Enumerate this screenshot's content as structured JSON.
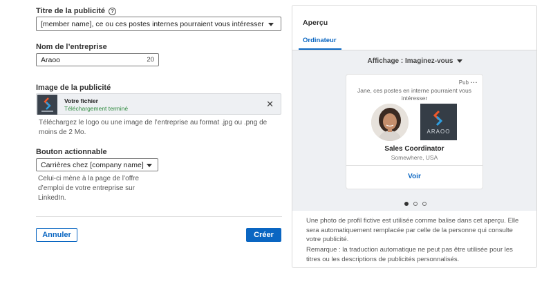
{
  "form": {
    "ad_title": {
      "label": "Titre de la publicité",
      "help_icon": "question-circle",
      "value": "[member name], ce ou ces postes internes pourraient vous intéresser"
    },
    "company_name": {
      "label": "Nom de l’entreprise",
      "value": "Araoo",
      "counter": "20"
    },
    "ad_image": {
      "label": "Image de la publicité",
      "file_label": "Votre fichier",
      "file_status": "Téléchargement terminé",
      "hint": "Téléchargez le logo ou une image de l’entreprise au format .jpg ou .png de moins de 2 Mo."
    },
    "cta_button": {
      "label": "Bouton actionnable",
      "value": "Carrières chez [company name]",
      "hint": "Celui-ci mène à la page de l’offre d’emploi de votre entreprise sur LinkedIn."
    }
  },
  "actions": {
    "cancel_label": "Annuler",
    "create_label": "Créer"
  },
  "preview": {
    "title": "Aperçu",
    "tab_label": "Ordinateur",
    "display_selector": "Affichage : Imaginez-vous",
    "card": {
      "badge": "Pub",
      "more_icon": "…",
      "headline": "Jane, ces postes en interne pourraient vous intéresser",
      "logo_text": "ARAOO",
      "role": "Sales Coordinator",
      "location": "Somewhere, USA",
      "cta_label": "Voir"
    },
    "pager": {
      "total": 3,
      "active_index": 0
    },
    "note_1": "Une photo de profil fictive est utilisée comme balise dans cet aperçu. Elle sera automatiquement remplacée par celle de la personne qui consulte votre publicité.",
    "note_2": "Remarque : la traduction automatique ne peut pas être utilisée pour les titres ou les descriptions de publicités personnalisés."
  },
  "colors": {
    "accent": "#0a66c2",
    "success": "#2e8a3e",
    "preview_bg": "#eef0f3",
    "logo_bg": "#353d46",
    "logo_orange": "#f0582a",
    "logo_blue": "#2f9fe0"
  }
}
